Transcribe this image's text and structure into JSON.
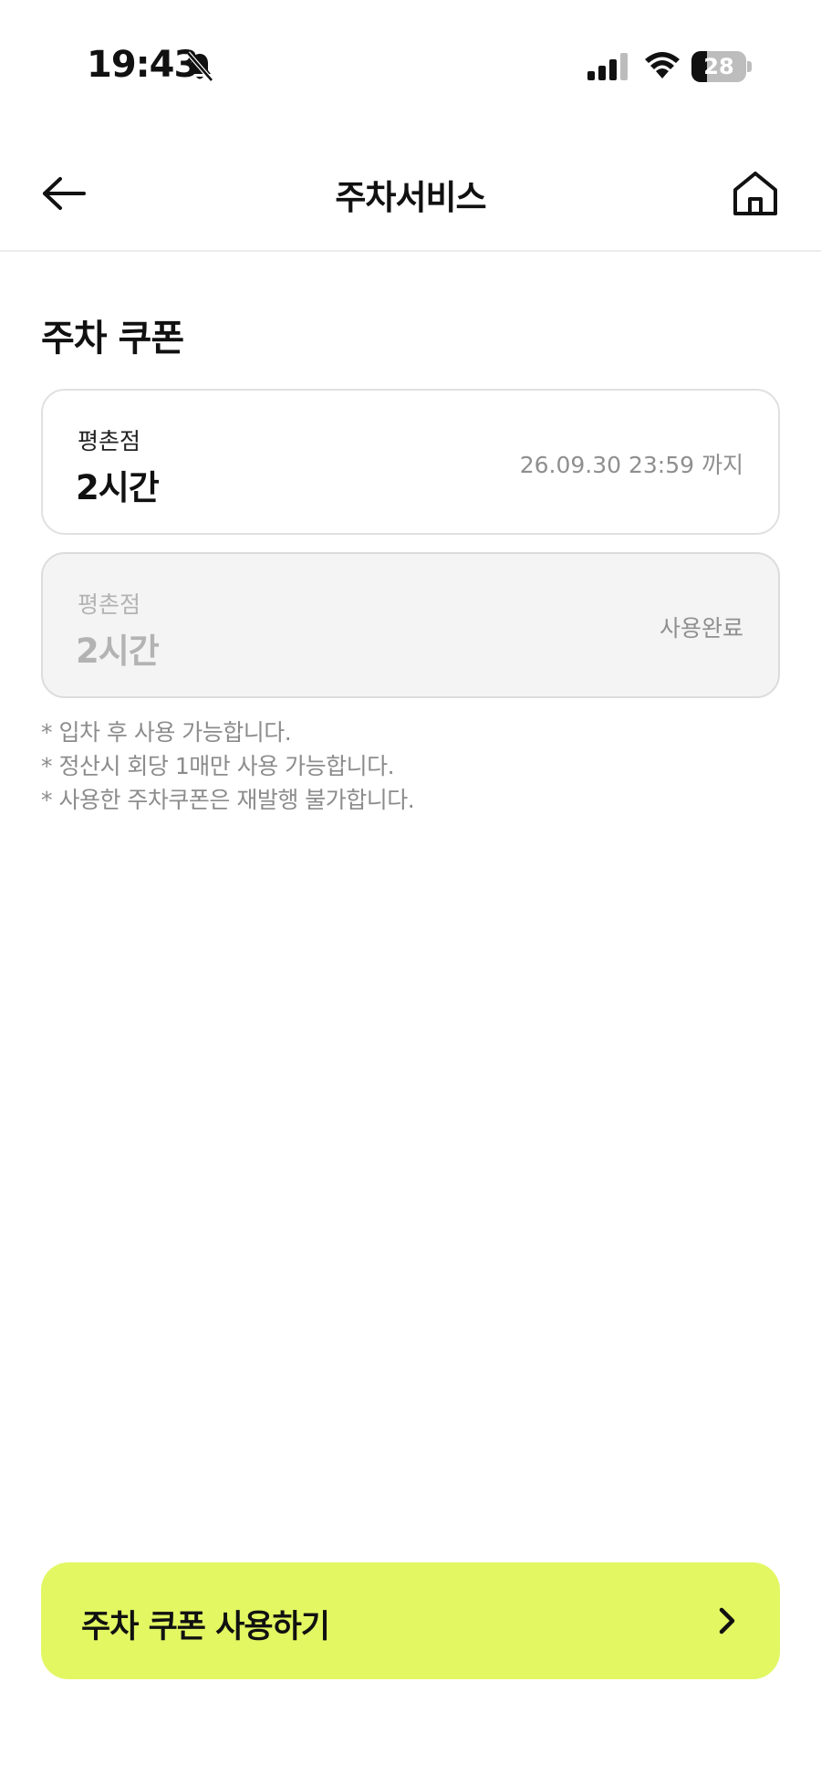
{
  "status_bar": {
    "time": "19:43",
    "battery_percent": "28",
    "battery_level": 0.28,
    "icons": [
      "bell-slash-icon",
      "signal-icon",
      "wifi-icon",
      "battery-icon"
    ]
  },
  "header": {
    "title": "주차서비스",
    "back_icon": "arrow-left-icon",
    "home_icon": "home-icon"
  },
  "section": {
    "title": "주차 쿠폰"
  },
  "coupons": [
    {
      "store": "평촌점",
      "duration": "2시간",
      "status": "26.09.30 23:59 까지",
      "used": false
    },
    {
      "store": "평촌점",
      "duration": "2시간",
      "status": "사용완료",
      "used": true
    }
  ],
  "notes": [
    "* 입차 후 사용 가능합니다.",
    "* 정산시 회당 1매만 사용 가능합니다.",
    "* 사용한 주차쿠폰은 재발행 불가합니다."
  ],
  "cta": {
    "label": "주차 쿠폰 사용하기",
    "icon": "chevron-right-icon"
  },
  "colors": {
    "cta_background": "#e2f762",
    "used_card_background": "#f4f4f4",
    "note_text": "#8c8c8c"
  }
}
